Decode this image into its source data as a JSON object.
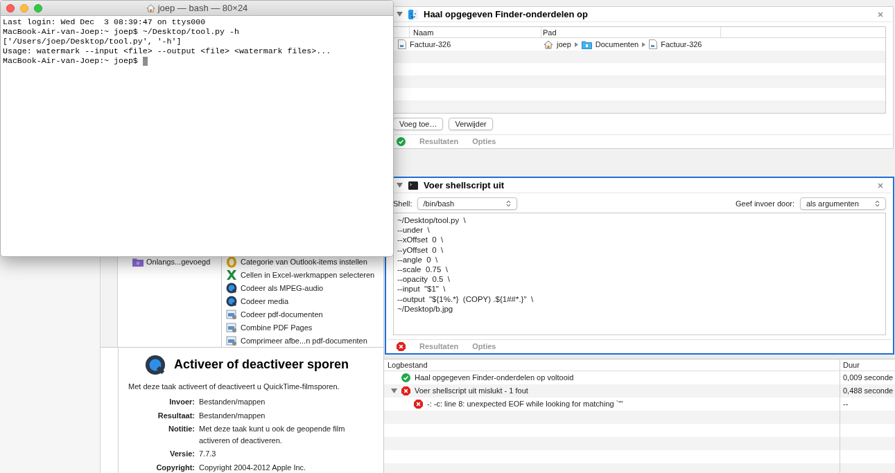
{
  "terminal": {
    "title": "joep — bash — 80×24",
    "cursor": true,
    "lines": [
      "Last login: Wed Dec  3 08:39:47 on ttys000",
      "MacBook-Air-van-Joep:~ joep$ ~/Desktop/tool.py -h",
      "['/Users/joep/Desktop/tool.py', '-h']",
      "Usage: watermark --input <file> --output <file> <watermark files>...",
      "MacBook-Air-van-Joep:~ joep$ "
    ]
  },
  "library": {
    "categories": [
      {
        "label": "Onlangs...gevoegd"
      }
    ],
    "actions": [
      {
        "label": "Categorie van Outlook-items instellen",
        "kind": "outlook"
      },
      {
        "label": "Cellen in Excel-werkmappen selecteren",
        "kind": "excel"
      },
      {
        "label": "Codeer als MPEG-audio",
        "kind": "quicktime"
      },
      {
        "label": "Codeer media",
        "kind": "quicktime"
      },
      {
        "label": "Codeer pdf-documenten",
        "kind": "preview"
      },
      {
        "label": "Combine PDF Pages",
        "kind": "preview"
      },
      {
        "label": "Comprimeer afbe...n pdf-documenten",
        "kind": "preview"
      }
    ]
  },
  "description": {
    "title": "Activeer of deactiveer sporen",
    "text": "Met deze taak activeert of deactiveert u QuickTime-filmsporen.",
    "fields": [
      {
        "label": "Invoer:",
        "value": "Bestanden/mappen"
      },
      {
        "label": "Resultaat:",
        "value": "Bestanden/mappen"
      },
      {
        "label": "Notitie:",
        "value": "Met deze taak kunt u ook de geopende film activeren of deactiveren."
      },
      {
        "label": "Versie:",
        "value": "7.7.3"
      },
      {
        "label": "Copyright:",
        "value": "Copyright 2004-2012 Apple Inc."
      }
    ]
  },
  "finder_action": {
    "title": "Haal opgegeven Finder-onderdelen op",
    "expanded": true,
    "selected": false,
    "failed": false,
    "columns": [
      "Naam",
      "Pad"
    ],
    "rows": [
      {
        "name": "Factuur-326",
        "path": [
          {
            "label": "joep",
            "kind": "home"
          },
          {
            "label": "Documenten",
            "kind": "folder"
          },
          {
            "label": "Factuur-326",
            "kind": "document"
          }
        ]
      }
    ],
    "buttons": [
      "Voeg toe…",
      "Verwijder"
    ],
    "tabs": [
      "Resultaten",
      "Opties"
    ]
  },
  "shell_action": {
    "title": "Voer shellscript uit",
    "expanded": true,
    "selected": true,
    "failed": true,
    "shell_label": "Shell:",
    "shell_value": "/bin/bash",
    "input_label": "Geef invoer door:",
    "input_value": "als argumenten",
    "script": [
      "~/Desktop/tool.py  \\",
      "--under  \\",
      "--xOffset  0  \\",
      "--yOffset  0  \\",
      "--angle  0  \\",
      "--scale  0.75  \\",
      "--opacity  0.5  \\",
      "--input  \"$1\"  \\",
      "--output  \"${1%.*}  (COPY) .${1##*.}\"  \\",
      "~/Desktop/b.jpg"
    ],
    "tabs": [
      "Resultaten",
      "Opties"
    ]
  },
  "log": {
    "columns": [
      "Logbestand",
      "Duur"
    ],
    "rows": [
      {
        "text": "Haal opgegeven Finder-onderdelen op voltooid",
        "duration": "0,009 seconde",
        "failed": false
      },
      {
        "text": "Voer shellscript uit mislukt - 1 fout",
        "duration": "0,488 seconde",
        "failed": true,
        "expanded": true,
        "children": [
          {
            "text": "-: -c: line 8: unexpected EOF while looking for matching `\"'",
            "duration": "--",
            "failed": true
          }
        ]
      }
    ]
  }
}
